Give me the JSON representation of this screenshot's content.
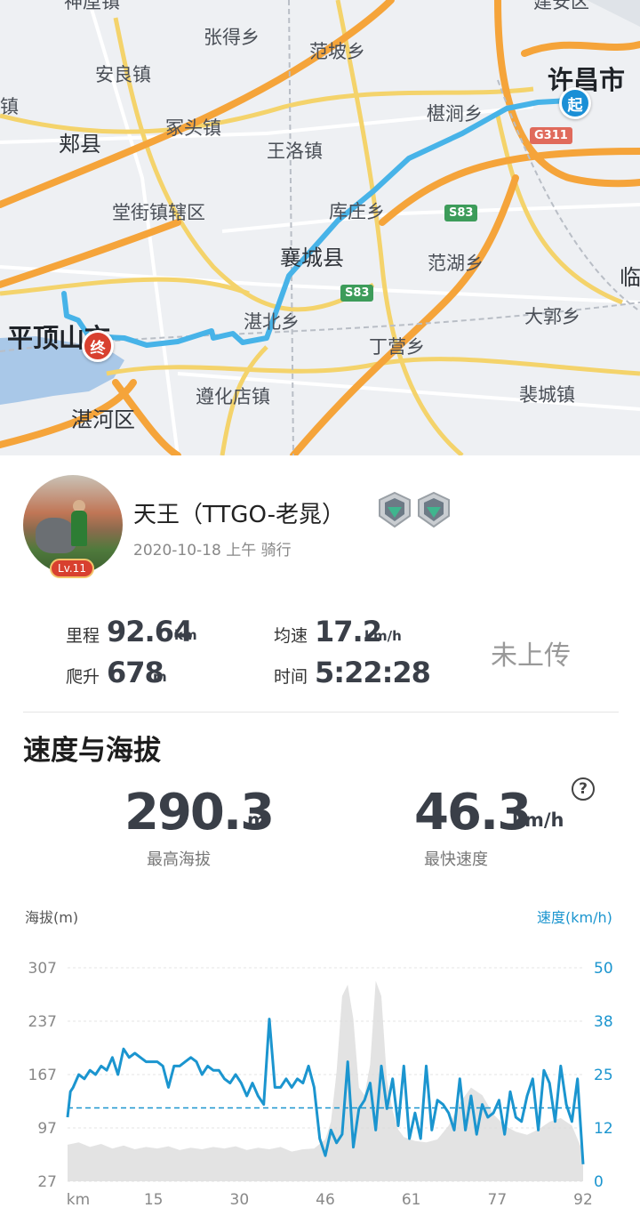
{
  "map": {
    "places": [
      {
        "name": "神垕镇",
        "cls": ""
      },
      {
        "name": "张得乡",
        "cls": ""
      },
      {
        "name": "范坡乡",
        "cls": ""
      },
      {
        "name": "建安区",
        "cls": ""
      },
      {
        "name": "安良镇",
        "cls": ""
      },
      {
        "name": "许昌市",
        "cls": "city"
      },
      {
        "name": "镇",
        "cls": ""
      },
      {
        "name": "椹涧乡",
        "cls": ""
      },
      {
        "name": "郏县",
        "cls": "county"
      },
      {
        "name": "冢头镇",
        "cls": ""
      },
      {
        "name": "王洛镇",
        "cls": ""
      },
      {
        "name": "堂街镇辖区",
        "cls": ""
      },
      {
        "name": "库庄乡",
        "cls": ""
      },
      {
        "name": "襄城县",
        "cls": "county"
      },
      {
        "name": "范湖乡",
        "cls": ""
      },
      {
        "name": "临",
        "cls": "county"
      },
      {
        "name": "大郭乡",
        "cls": ""
      },
      {
        "name": "平顶山市",
        "cls": "city"
      },
      {
        "name": "湛北乡",
        "cls": ""
      },
      {
        "name": "丁营乡",
        "cls": ""
      },
      {
        "name": "遵化店镇",
        "cls": ""
      },
      {
        "name": "裴城镇",
        "cls": ""
      },
      {
        "name": "湛河区",
        "cls": "county"
      }
    ],
    "highways": {
      "g311": "G311",
      "s83a": "S83",
      "s83b": "S83"
    },
    "start_label": "起",
    "end_label": "终"
  },
  "user": {
    "name": "天王（TTGO-老晁）",
    "level": "Lv.11",
    "meta": "2020-10-18 上午 骑行"
  },
  "stats": {
    "distance": {
      "label": "里程",
      "value": "92.64",
      "unit": "km"
    },
    "climb": {
      "label": "爬升",
      "value": "678",
      "unit": "m"
    },
    "avg_speed": {
      "label": "均速",
      "value": "17.2",
      "unit": "km/h"
    },
    "time": {
      "label": "时间",
      "value": "5:22:28"
    },
    "upload_status": "未上传"
  },
  "section": {
    "title": "速度与海拔",
    "max_altitude": {
      "value": "290.3",
      "unit": "m",
      "label": "最高海拔"
    },
    "max_speed": {
      "value": "46.3",
      "unit": "km/h",
      "label": "最快速度"
    },
    "help": "?"
  },
  "chart_data": {
    "type": "line",
    "y_left_label": "海拔(m)",
    "y_right_label": "速度(km/h)",
    "y_left_ticks": [
      "307",
      "237",
      "167",
      "97",
      "27"
    ],
    "y_right_ticks": [
      "50",
      "38",
      "25",
      "12",
      "0"
    ],
    "x_ticks": [
      "km",
      "15",
      "30",
      "46",
      "61",
      "77",
      "92"
    ],
    "x_range": [
      0,
      92
    ],
    "altitude_range": [
      27,
      307
    ],
    "speed_range": [
      0,
      50
    ],
    "average_speed": 17.2,
    "colors": {
      "speed": "#1b95cf",
      "altitude_fill": "#d9d9d9",
      "tick": "#888888",
      "right_tick": "#1b95cf"
    },
    "series": [
      {
        "name": "速度",
        "x": [
          0,
          0.5,
          1,
          2,
          3,
          4,
          5,
          6,
          7,
          8,
          9,
          10,
          11,
          12,
          13,
          14,
          15,
          16,
          17,
          18,
          19,
          20,
          21,
          22,
          23,
          24,
          25,
          26,
          27,
          28,
          29,
          30,
          31,
          32,
          33,
          34,
          35,
          36,
          37,
          38,
          39,
          40,
          41,
          42,
          43,
          44,
          45,
          46,
          47,
          48,
          49,
          50,
          51,
          52,
          53,
          54,
          55,
          56,
          57,
          58,
          59,
          60,
          61,
          62,
          63,
          64,
          65,
          66,
          67,
          68,
          69,
          70,
          71,
          72,
          73,
          74,
          75,
          76,
          77,
          78,
          79,
          80,
          81,
          82,
          83,
          84,
          85,
          86,
          87,
          88,
          89,
          90,
          91,
          92
        ],
        "values": [
          15,
          21,
          22,
          25,
          24,
          26,
          25,
          27,
          26,
          29,
          25,
          31,
          29,
          30,
          29,
          28,
          28,
          28,
          27,
          22,
          27,
          27,
          28,
          29,
          28,
          25,
          27,
          26,
          26,
          24,
          23,
          25,
          23,
          20,
          23,
          20,
          18,
          38,
          22,
          22,
          24,
          22,
          24,
          23,
          27,
          22,
          10,
          6,
          12,
          9,
          11,
          28,
          8,
          17,
          19,
          23,
          12,
          27,
          17,
          24,
          13,
          27,
          10,
          16,
          10,
          27,
          12,
          19,
          18,
          16,
          12,
          24,
          12,
          20,
          11,
          18,
          15,
          16,
          19,
          11,
          21,
          15,
          14,
          20,
          24,
          12,
          26,
          23,
          14,
          27,
          18,
          14,
          24,
          4
        ]
      },
      {
        "name": "海拔",
        "x": [
          0,
          2,
          4,
          6,
          8,
          10,
          12,
          14,
          16,
          18,
          20,
          22,
          24,
          26,
          28,
          30,
          32,
          34,
          36,
          38,
          40,
          42,
          44,
          46,
          47,
          48,
          49,
          50,
          51,
          52,
          53,
          54,
          55,
          56,
          57,
          58,
          59,
          60,
          62,
          64,
          66,
          68,
          70,
          72,
          74,
          76,
          78,
          80,
          82,
          84,
          86,
          88,
          90,
          92
        ],
        "values": [
          75,
          78,
          72,
          76,
          70,
          74,
          69,
          72,
          70,
          73,
          68,
          71,
          69,
          72,
          70,
          73,
          68,
          71,
          69,
          72,
          66,
          69,
          70,
          82,
          105,
          170,
          270,
          285,
          240,
          150,
          140,
          180,
          290,
          270,
          160,
          120,
          95,
          85,
          80,
          78,
          82,
          100,
          130,
          150,
          140,
          115,
          100,
          92,
          88,
          95,
          105,
          110,
          100,
          65
        ]
      }
    ]
  }
}
